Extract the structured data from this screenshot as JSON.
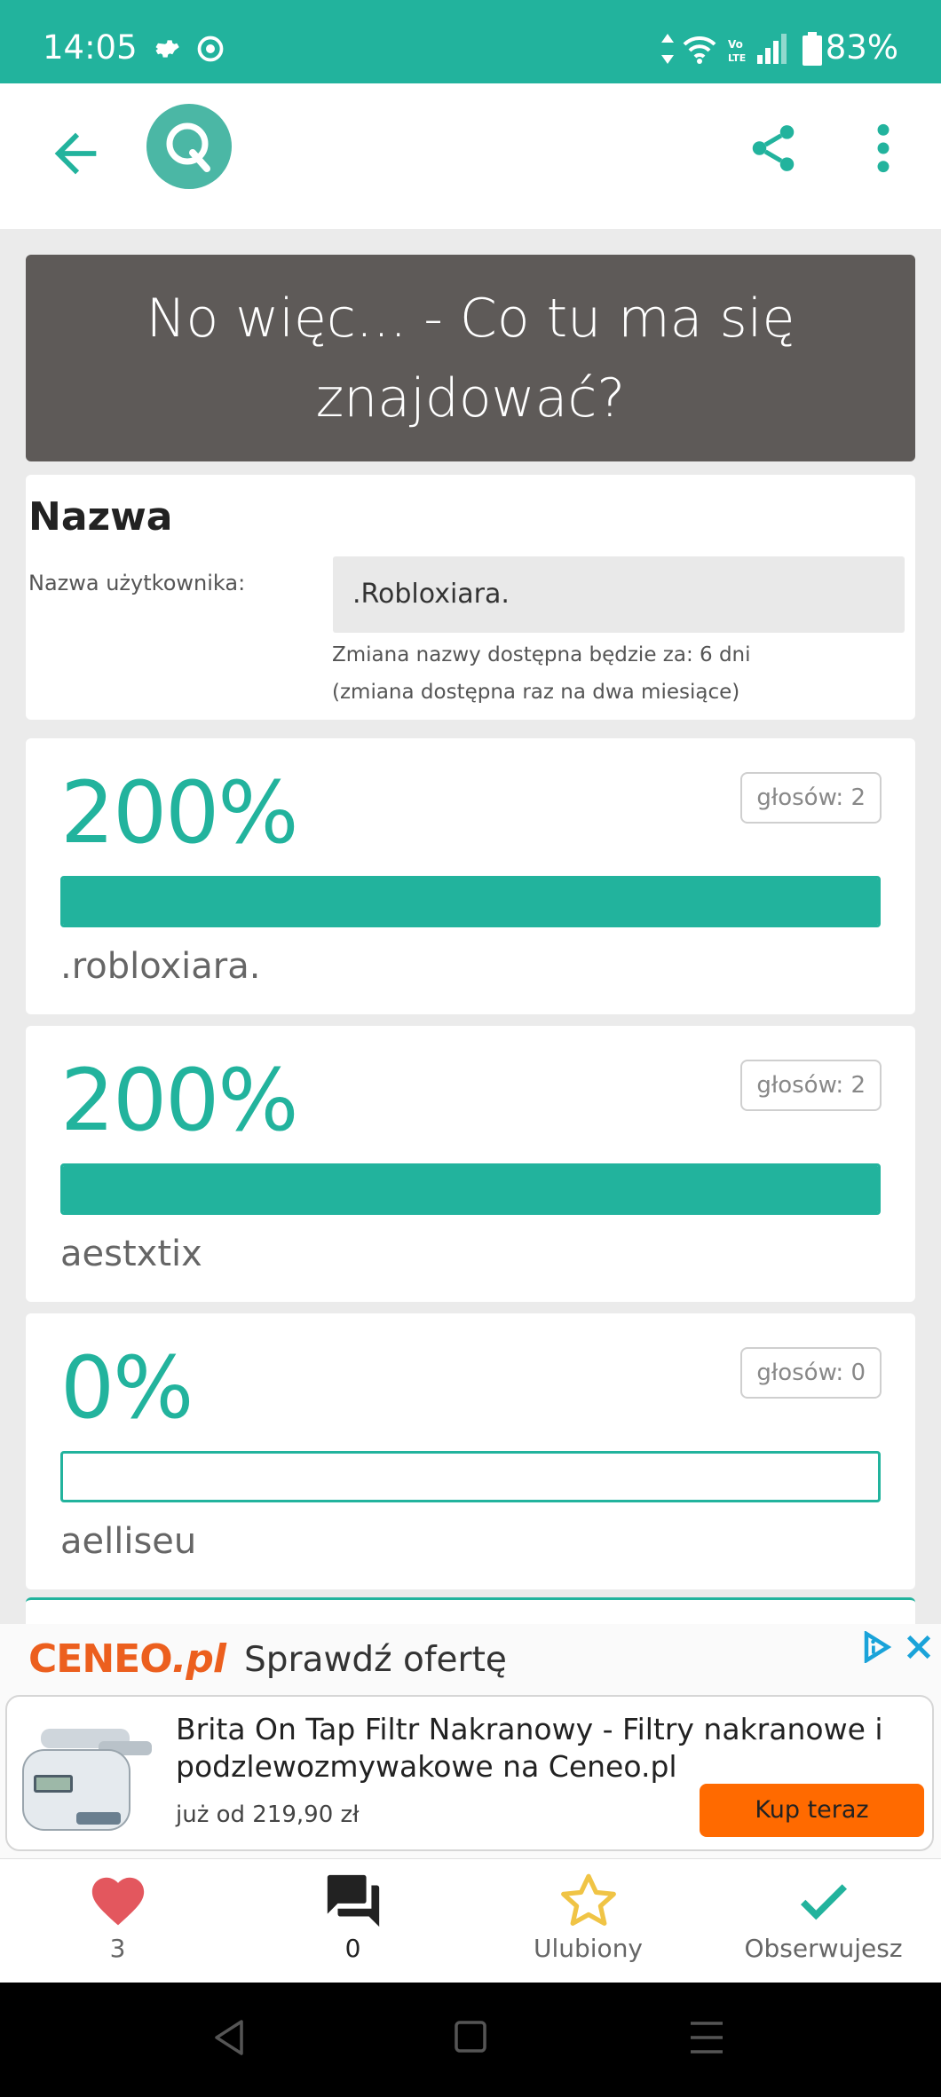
{
  "status_bar": {
    "time": "14:05",
    "battery": "83%"
  },
  "title": "No więc... - Co tu ma się znajdować?",
  "name_section": {
    "heading": "Nazwa",
    "label": "Nazwa użytkownika:",
    "value": ".Robloxiara.",
    "note_line1": "Zmiana nazwy dostępna będzie za: 6 dni",
    "note_line2": "(zmiana dostępna raz na dwa miesiące)"
  },
  "poll_options": [
    {
      "percent_text": "200%",
      "fill_fraction": 1.0,
      "votes_text": "głosów: 2",
      "label": ".robloxiara."
    },
    {
      "percent_text": "200%",
      "fill_fraction": 1.0,
      "votes_text": "głosów: 2",
      "label": "aestxtix"
    },
    {
      "percent_text": "0%",
      "fill_fraction": 0.0,
      "votes_text": "głosów: 0",
      "label": "aelliseu"
    }
  ],
  "ad": {
    "brand_main": "CENEO",
    "brand_suffix": ".pl",
    "headline": "Sprawdź ofertę",
    "product_title": "Brita On Tap Filtr Nakranowy - Filtry nakranowe i podzlewozmywakowe na Ceneo.pl",
    "price": "już od 219,90 zł",
    "buy_label": "Kup teraz"
  },
  "actions": {
    "likes": "3",
    "comments": "0",
    "favorite": "Ulubiony",
    "follow": "Obserwujesz"
  },
  "colors": {
    "accent": "#22b39d",
    "title_bg": "#5e5a58",
    "ad_orange": "#ff6a00",
    "heart": "#e3575e",
    "star": "#f0c445"
  },
  "icons": [
    "wifi-icon",
    "signal-icon",
    "battery-icon",
    "back-arrow-icon",
    "share-icon",
    "more-vertical-icon",
    "heart-icon",
    "comments-icon",
    "star-icon",
    "check-icon"
  ]
}
